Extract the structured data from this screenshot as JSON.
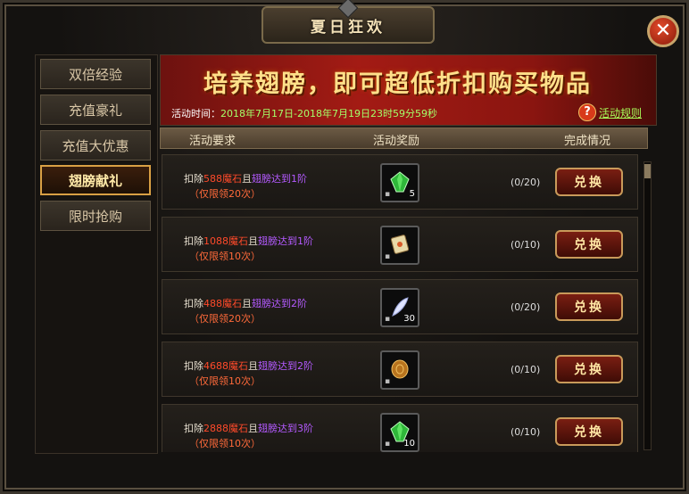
{
  "window": {
    "title": "夏日狂欢",
    "close_label": "✕"
  },
  "sidebar": {
    "items": [
      {
        "label": "双倍经验",
        "active": false
      },
      {
        "label": "充值豪礼",
        "active": false
      },
      {
        "label": "充值大优惠",
        "active": false
      },
      {
        "label": "翅膀献礼",
        "active": true
      },
      {
        "label": "限时抢购",
        "active": false
      }
    ]
  },
  "banner": {
    "slogan": "培养翅膀，即可超低折扣购买物品",
    "time_label": "活动时间：",
    "time_value": "2018年7月17日-2018年7月19日23时59分59秒",
    "help_icon": "?",
    "rules_link": "活动规则"
  },
  "columns": {
    "requirement": "活动要求",
    "reward": "活动奖励",
    "status": "完成情况"
  },
  "rows": [
    {
      "cost_prefix": "扣除",
      "cost_amount": "588魔石",
      "joiner": "且",
      "wing": "翅膀达到1阶",
      "limit": "（仅限领20次）",
      "item_icon": "green-gem-icon",
      "item_count": "5",
      "progress": "(0/20)",
      "button": "兑换"
    },
    {
      "cost_prefix": "扣除",
      "cost_amount": "1088魔石",
      "joiner": "且",
      "wing": "翅膀达到1阶",
      "limit": "（仅限领10次）",
      "item_icon": "scroll-icon",
      "item_count": "",
      "progress": "(0/10)",
      "button": "兑换"
    },
    {
      "cost_prefix": "扣除",
      "cost_amount": "488魔石",
      "joiner": "且",
      "wing": "翅膀达到2阶",
      "limit": "（仅限领20次）",
      "item_icon": "feather-icon",
      "item_count": "30",
      "progress": "(0/20)",
      "button": "兑换"
    },
    {
      "cost_prefix": "扣除",
      "cost_amount": "4688魔石",
      "joiner": "且",
      "wing": "翅膀达到2阶",
      "limit": "（仅限领10次）",
      "item_icon": "coin-icon",
      "item_count": "",
      "progress": "(0/10)",
      "button": "兑换"
    },
    {
      "cost_prefix": "扣除",
      "cost_amount": "2888魔石",
      "joiner": "且",
      "wing": "翅膀达到3阶",
      "limit": "（仅限领10次）",
      "item_icon": "green-gem-icon",
      "item_count": "10",
      "progress": "(0/10)",
      "button": "兑换"
    }
  ],
  "colors": {
    "cost_red": "#ff4a2a",
    "wing_purple": "#b45aff",
    "accent_gold": "#d9a044"
  }
}
